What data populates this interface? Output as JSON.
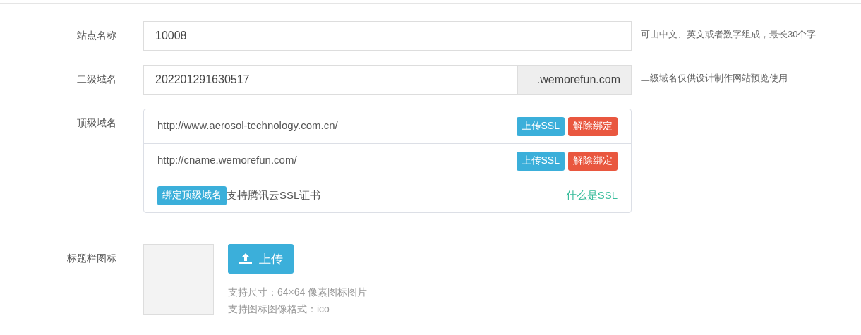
{
  "site_name": {
    "label": "站点名称",
    "value": "10008",
    "hint": "可由中文、英文或者数字组成，最长30个字"
  },
  "subdomain": {
    "label": "二级域名",
    "value": "202201291630517",
    "suffix": ".wemorefun.com",
    "hint": "二级域名仅供设计制作网站预览使用"
  },
  "top_domain": {
    "label": "顶级域名",
    "domains": [
      {
        "url": "http://www.aerosol-technology.com.cn/",
        "upload_button": "上传SSL",
        "unbind_button": "解除绑定"
      },
      {
        "url": "http://cname.wemorefun.com/",
        "upload_button": "上传SSL",
        "unbind_button": "解除绑定"
      }
    ],
    "bind_button": "绑定顶级域名",
    "bind_note": "支持腾讯云SSL证书",
    "ssl_link": "什么是SSL"
  },
  "favicon": {
    "label": "标题栏图标",
    "upload_button": "上传",
    "hints": [
      "支持尺寸：64×64 像素图标图片",
      "支持图标图像格式：ico"
    ]
  }
}
